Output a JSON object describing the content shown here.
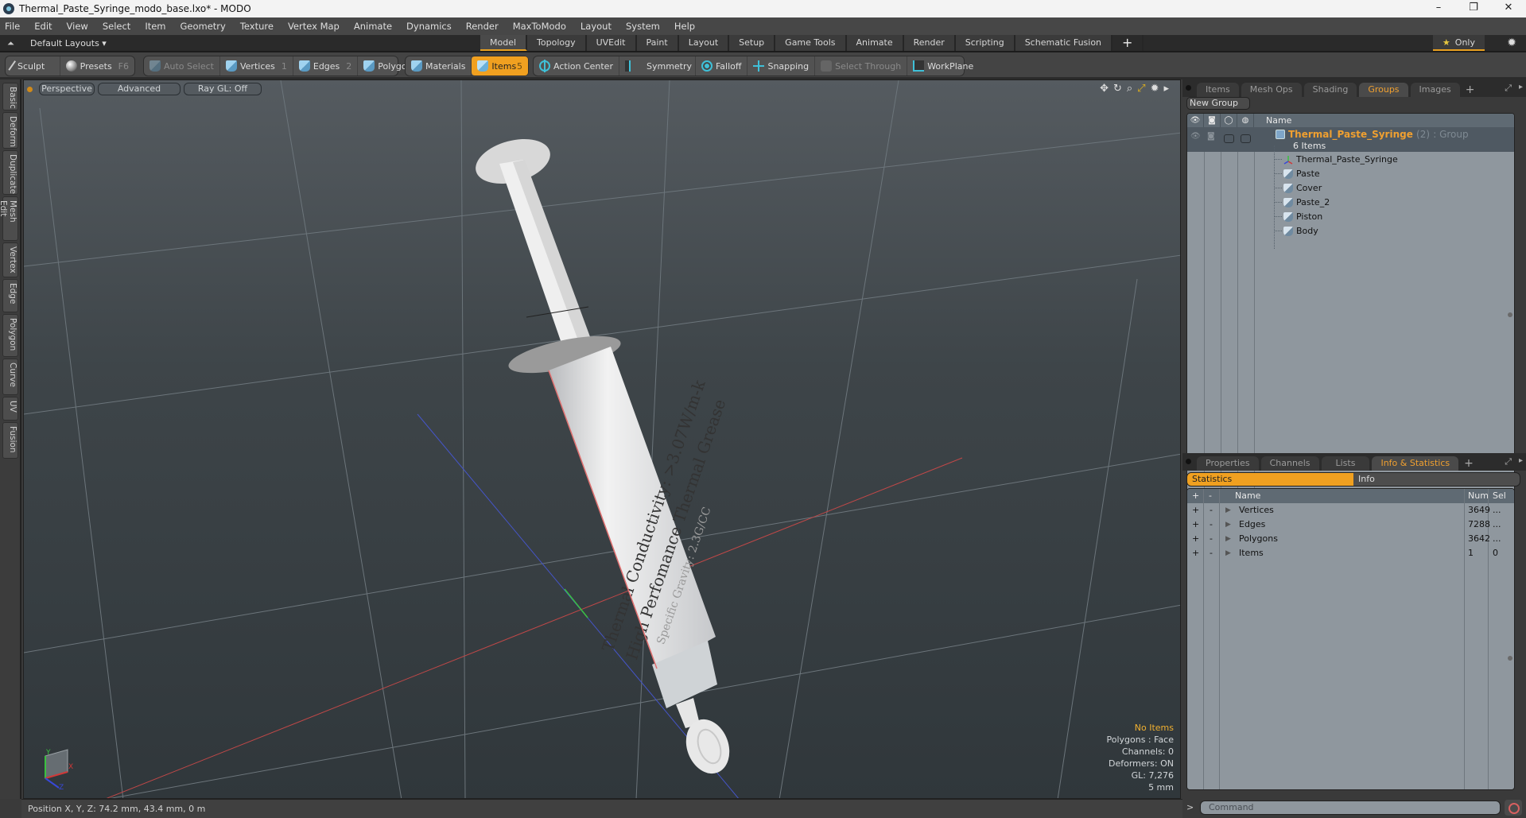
{
  "window": {
    "title": "Thermal_Paste_Syringe_modo_base.lxo* - MODO",
    "controls": [
      "minimize",
      "restore",
      "close"
    ]
  },
  "menu": [
    "File",
    "Edit",
    "View",
    "Select",
    "Item",
    "Geometry",
    "Texture",
    "Vertex Map",
    "Animate",
    "Dynamics",
    "Render",
    "MaxToModo",
    "Layout",
    "System",
    "Help"
  ],
  "layout_bar": {
    "layout_name": "Default Layouts ▾",
    "tabs": [
      "Model",
      "Topology",
      "UVEdit",
      "Paint",
      "Layout",
      "Setup",
      "Game Tools",
      "Animate",
      "Render",
      "Scripting",
      "Schematic Fusion"
    ],
    "active_tab": "Model",
    "add_tab": "+",
    "only_label": "Only"
  },
  "toolbar": {
    "sculpt": "Sculpt",
    "presets": "Presets",
    "presets_key": "F6",
    "auto_select": "Auto Select",
    "vertices": "Vertices",
    "vertices_key": "1",
    "edges": "Edges",
    "edges_key": "2",
    "polygons": "Polygons",
    "materials": "Materials",
    "items": "Items",
    "items_key": "5",
    "action_center": "Action Center",
    "symmetry": "Symmetry",
    "falloff": "Falloff",
    "snapping": "Snapping",
    "select_through": "Select Through",
    "workplane": "WorkPlane"
  },
  "left_tabs": [
    "Basic",
    "Deform",
    "Duplicate",
    "Mesh Edit",
    "Vertex",
    "Edge",
    "Polygon",
    "Curve",
    "UV",
    "Fusion"
  ],
  "viewport": {
    "view_mode": "Perspective",
    "shading": "Advanced",
    "raygl": "Ray GL: Off",
    "info": {
      "selection": "No Items",
      "polygons": "Polygons : Face",
      "channels": "Channels: 0",
      "deformers": "Deformers: ON",
      "gl": "GL: 7,276",
      "scale": "5 mm"
    },
    "model_label": {
      "line1": "Thermal Conductivity: >3.07W/m-k",
      "line2": "High Perfomance Thermal Grease",
      "line3": "Specific Gravity: 2.3G/CC"
    },
    "axes": {
      "x": "X",
      "y": "Y",
      "z": "Z"
    }
  },
  "groups_panel": {
    "tabs": [
      "Items",
      "Mesh Ops",
      "Shading",
      "Groups",
      "Images"
    ],
    "active_tab": "Groups",
    "new_group": "New Group",
    "column_name": "Name",
    "group": {
      "name": "Thermal_Paste_Syringe",
      "count": "(2)",
      "type": ": Group",
      "items_label": "6 Items"
    },
    "children": [
      {
        "name": "Thermal_Paste_Syringe",
        "kind": "locator"
      },
      {
        "name": "Paste",
        "kind": "mesh"
      },
      {
        "name": "Cover",
        "kind": "mesh"
      },
      {
        "name": "Paste_2",
        "kind": "mesh"
      },
      {
        "name": "Piston",
        "kind": "mesh"
      },
      {
        "name": "Body",
        "kind": "mesh"
      }
    ]
  },
  "stats_panel": {
    "tabs": [
      "Properties",
      "Channels",
      "Lists",
      "Info & Statistics"
    ],
    "active_tab": "Info & Statistics",
    "subtabs": [
      "Statistics",
      "Info"
    ],
    "active_subtab": "Statistics",
    "columns": {
      "add": "+",
      "remove": "-",
      "name": "Name",
      "num": "Num",
      "sel": "Sel"
    },
    "rows": [
      {
        "name": "Vertices",
        "num": "3649",
        "sel": "..."
      },
      {
        "name": "Edges",
        "num": "7288",
        "sel": "..."
      },
      {
        "name": "Polygons",
        "num": "3642",
        "sel": "..."
      },
      {
        "name": "Items",
        "num": "1",
        "sel": "0"
      }
    ]
  },
  "command": {
    "prompt": ">",
    "placeholder": "Command"
  },
  "status": {
    "position": "Position X, Y, Z:   74.2 mm, 43.4 mm, 0 m"
  },
  "colors": {
    "accent": "#f0a020",
    "panel_bg": "#8f979e",
    "viewport_top": "#555b60",
    "viewport_bottom": "#30373b"
  }
}
